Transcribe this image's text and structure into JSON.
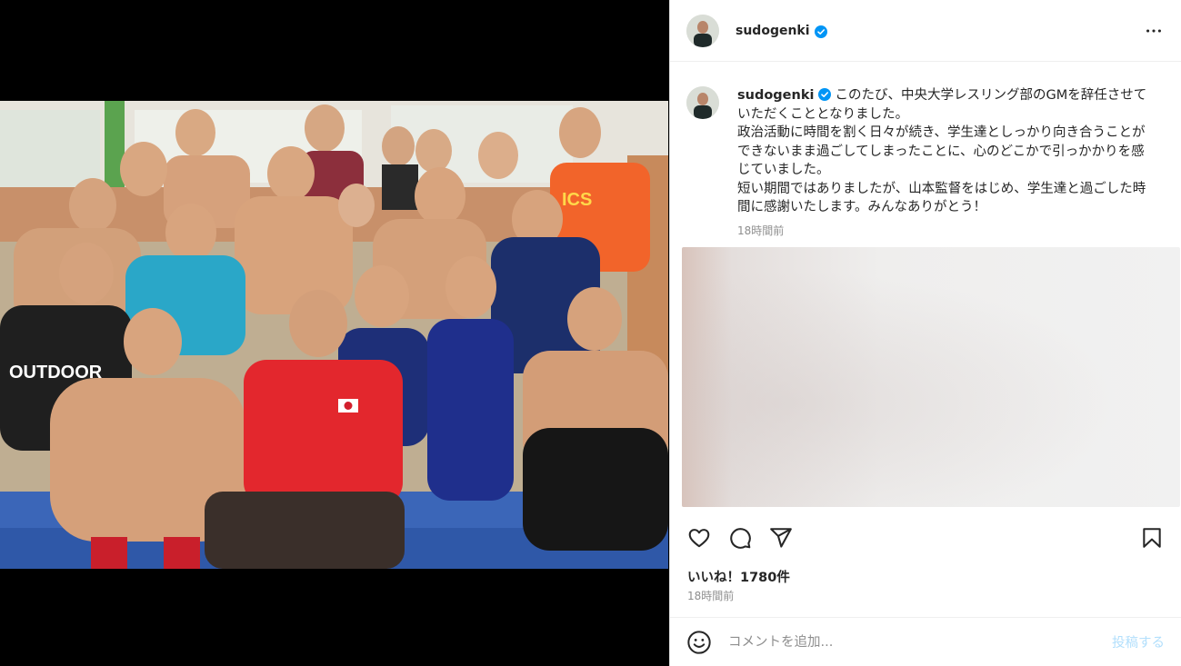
{
  "post": {
    "username": "sudogenki",
    "caption": "このたび、中央大学レスリング部のGMを辞任させていただくこととなりました。\n政治活動に時間を割く日々が続き、学生達としっかり向き合うことができないまま過ごしてしまったことに、心のどこかで引っかかりを感じていました。\n短い期間ではありましたが、山本監督をはじめ、学生達と過ごした時間に感謝いたします。みんなありがとう！",
    "caption_time": "18時間前",
    "likes": "いいね！1780件",
    "post_time": "18時間前",
    "photo_shirt_text": "OUTDOOR",
    "photo_shirt_text_2": "ICS"
  },
  "comment": {
    "placeholder": "コメントを追加...",
    "post_label": "投稿する"
  },
  "icons": {
    "verified": "verified-badge-icon",
    "more": "more-options-icon",
    "like": "heart-icon",
    "comment": "comment-icon",
    "share": "share-icon",
    "save": "bookmark-icon",
    "emoji": "emoji-icon"
  },
  "colors": {
    "verified_blue": "#0095f6",
    "post_button_disabled": "#b2dffc",
    "secondary_text": "#8e8e8e"
  }
}
